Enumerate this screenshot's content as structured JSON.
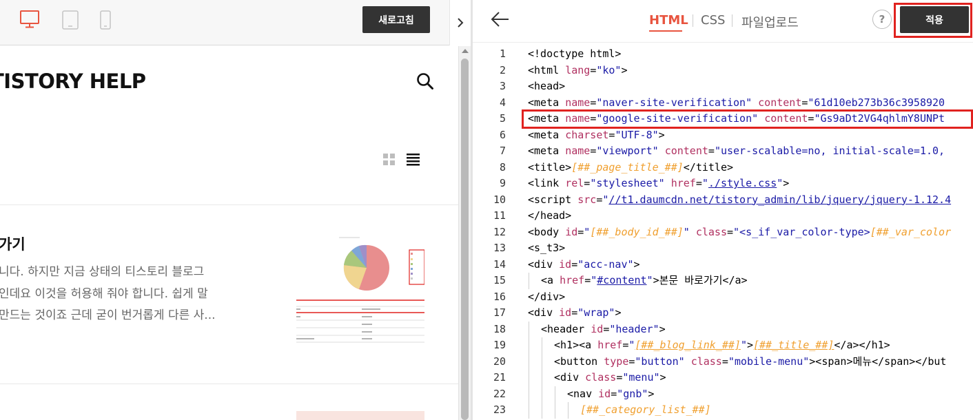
{
  "left_toolbar": {
    "refresh_label": "새로고침",
    "device_icons": [
      "desktop-icon",
      "tablet-icon",
      "mobile-icon"
    ],
    "active_device": "desktop"
  },
  "preview": {
    "blog_title": "TISTORY HELP",
    "post": {
      "title": "가기",
      "lines": [
        "니다. 하지만 지금 상태의 티스토리 블로그",
        "인데요 이것을 허용해 줘야 합니다. 쉽게 말",
        "만드는 것이죠 근데 굳이 번거롭게 다른 사..."
      ]
    }
  },
  "editor_toolbar": {
    "tabs": [
      "HTML",
      "CSS",
      "파일업로드"
    ],
    "active_tab": "HTML",
    "help_label": "?",
    "apply_label": "적용"
  },
  "colors": {
    "accent": "#e8543f",
    "highlight_border": "#e0221f",
    "button_bg": "#333333",
    "code_attr": "#b03060",
    "code_string": "#1a1aa6",
    "code_var": "#f0a030"
  },
  "code_lines": [
    {
      "n": "1",
      "indent": 0,
      "tokens": [
        [
          "n",
          "<!doctype html>"
        ]
      ]
    },
    {
      "n": "2",
      "indent": 0,
      "tokens": [
        [
          "n",
          "<html "
        ],
        [
          "a",
          "lang"
        ],
        [
          "n",
          "="
        ],
        [
          "s",
          "\"ko\""
        ],
        [
          "n",
          ">"
        ]
      ]
    },
    {
      "n": "3",
      "indent": 0,
      "tokens": [
        [
          "n",
          "<head>"
        ]
      ]
    },
    {
      "n": "4",
      "indent": 0,
      "tokens": [
        [
          "n",
          "<meta "
        ],
        [
          "a",
          "name"
        ],
        [
          "n",
          "="
        ],
        [
          "s",
          "\"naver-site-verification\""
        ],
        [
          "n",
          " "
        ],
        [
          "a",
          "content"
        ],
        [
          "n",
          "="
        ],
        [
          "s",
          "\"61d10eb273b36c3958920"
        ]
      ]
    },
    {
      "n": "5",
      "indent": 0,
      "tokens": [
        [
          "n",
          "<meta "
        ],
        [
          "a",
          "name"
        ],
        [
          "n",
          "="
        ],
        [
          "s",
          "\"google-site-verification\""
        ],
        [
          "n",
          " "
        ],
        [
          "a",
          "content"
        ],
        [
          "n",
          "="
        ],
        [
          "s",
          "\"Gs9aDt2VG4qhlmY8UNPt"
        ]
      ]
    },
    {
      "n": "6",
      "indent": 0,
      "tokens": [
        [
          "n",
          "<meta "
        ],
        [
          "a",
          "charset"
        ],
        [
          "n",
          "="
        ],
        [
          "s",
          "\"UTF-8\""
        ],
        [
          "n",
          ">"
        ]
      ]
    },
    {
      "n": "7",
      "indent": 0,
      "tokens": [
        [
          "n",
          "<meta "
        ],
        [
          "a",
          "name"
        ],
        [
          "n",
          "="
        ],
        [
          "s",
          "\"viewport\""
        ],
        [
          "n",
          " "
        ],
        [
          "a",
          "content"
        ],
        [
          "n",
          "="
        ],
        [
          "s",
          "\"user-scalable=no, initial-scale=1.0,"
        ]
      ]
    },
    {
      "n": "8",
      "indent": 0,
      "tokens": [
        [
          "n",
          "<title>"
        ],
        [
          "v",
          "[##_page_title_##]"
        ],
        [
          "n",
          "</title>"
        ]
      ]
    },
    {
      "n": "9",
      "indent": 0,
      "tokens": [
        [
          "n",
          "<link "
        ],
        [
          "a",
          "rel"
        ],
        [
          "n",
          "="
        ],
        [
          "s",
          "\"stylesheet\""
        ],
        [
          "n",
          " "
        ],
        [
          "a",
          "href"
        ],
        [
          "n",
          "="
        ],
        [
          "s",
          "\""
        ],
        [
          "l",
          "./style.css"
        ],
        [
          "s",
          "\""
        ],
        [
          "n",
          ">"
        ]
      ]
    },
    {
      "n": "10",
      "indent": 0,
      "tokens": [
        [
          "n",
          "<script "
        ],
        [
          "a",
          "src"
        ],
        [
          "n",
          "="
        ],
        [
          "s",
          "\""
        ],
        [
          "l",
          "//t1.daumcdn.net/tistory_admin/lib/jquery/jquery-1.12.4"
        ]
      ]
    },
    {
      "n": "11",
      "indent": 0,
      "tokens": [
        [
          "n",
          "</head>"
        ]
      ]
    },
    {
      "n": "12",
      "indent": 0,
      "tokens": [
        [
          "n",
          "<body "
        ],
        [
          "a",
          "id"
        ],
        [
          "n",
          "="
        ],
        [
          "s",
          "\""
        ],
        [
          "v",
          "[##_body_id_##]"
        ],
        [
          "s",
          "\""
        ],
        [
          "n",
          " "
        ],
        [
          "a",
          "class"
        ],
        [
          "n",
          "="
        ],
        [
          "s",
          "\"<s_if_var_color-type>"
        ],
        [
          "v",
          "[##_var_color"
        ]
      ]
    },
    {
      "n": "13",
      "indent": 0,
      "tokens": [
        [
          "n",
          "<s_t3>"
        ]
      ]
    },
    {
      "n": "14",
      "indent": 0,
      "tokens": [
        [
          "n",
          "<div "
        ],
        [
          "a",
          "id"
        ],
        [
          "n",
          "="
        ],
        [
          "s",
          "\"acc-nav\""
        ],
        [
          "n",
          ">"
        ]
      ]
    },
    {
      "n": "15",
      "indent": 1,
      "tokens": [
        [
          "n",
          "<a "
        ],
        [
          "a",
          "href"
        ],
        [
          "n",
          "="
        ],
        [
          "s",
          "\""
        ],
        [
          "l",
          "#content"
        ],
        [
          "s",
          "\""
        ],
        [
          "n",
          ">본문 바로가기</a>"
        ]
      ]
    },
    {
      "n": "16",
      "indent": 0,
      "tokens": [
        [
          "n",
          "</div>"
        ]
      ]
    },
    {
      "n": "17",
      "indent": 0,
      "tokens": [
        [
          "n",
          "<div "
        ],
        [
          "a",
          "id"
        ],
        [
          "n",
          "="
        ],
        [
          "s",
          "\"wrap\""
        ],
        [
          "n",
          ">"
        ]
      ]
    },
    {
      "n": "18",
      "indent": 1,
      "tokens": [
        [
          "n",
          "<header "
        ],
        [
          "a",
          "id"
        ],
        [
          "n",
          "="
        ],
        [
          "s",
          "\"header\""
        ],
        [
          "n",
          ">"
        ]
      ]
    },
    {
      "n": "19",
      "indent": 2,
      "tokens": [
        [
          "n",
          "<h1><a "
        ],
        [
          "a",
          "href"
        ],
        [
          "n",
          "="
        ],
        [
          "s",
          "\""
        ],
        [
          "vl",
          "[##_blog_link_##]"
        ],
        [
          "s",
          "\""
        ],
        [
          "n",
          ">"
        ],
        [
          "vl",
          "[##_title_##]"
        ],
        [
          "n",
          "</a></h1>"
        ]
      ]
    },
    {
      "n": "20",
      "indent": 2,
      "tokens": [
        [
          "n",
          "<button "
        ],
        [
          "a",
          "type"
        ],
        [
          "n",
          "="
        ],
        [
          "s",
          "\"button\""
        ],
        [
          "n",
          " "
        ],
        [
          "a",
          "class"
        ],
        [
          "n",
          "="
        ],
        [
          "s",
          "\"mobile-menu\""
        ],
        [
          "n",
          "><span>메뉴</span></but"
        ]
      ]
    },
    {
      "n": "21",
      "indent": 2,
      "tokens": [
        [
          "n",
          "<div "
        ],
        [
          "a",
          "class"
        ],
        [
          "n",
          "="
        ],
        [
          "s",
          "\"menu\""
        ],
        [
          "n",
          ">"
        ]
      ]
    },
    {
      "n": "22",
      "indent": 3,
      "tokens": [
        [
          "n",
          "<nav "
        ],
        [
          "a",
          "id"
        ],
        [
          "n",
          "="
        ],
        [
          "s",
          "\"gnb\""
        ],
        [
          "n",
          ">"
        ]
      ]
    },
    {
      "n": "23",
      "indent": 4,
      "tokens": [
        [
          "v",
          "[##_category_list_##]"
        ]
      ]
    }
  ]
}
